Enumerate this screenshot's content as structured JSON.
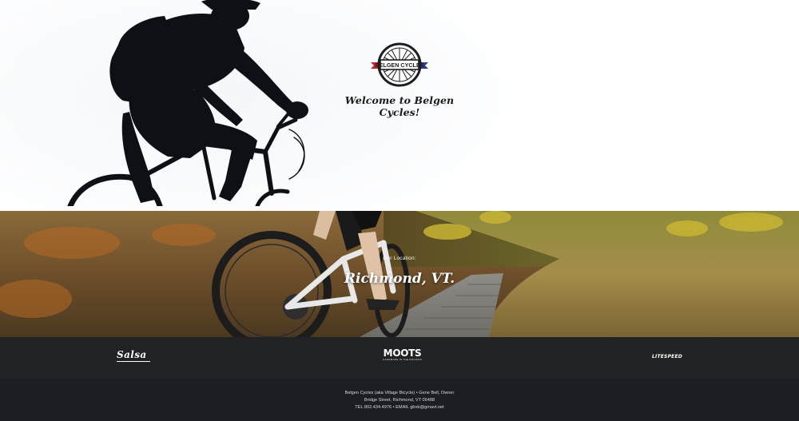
{
  "hero": {
    "welcome_text": "Welcome to Belgen Cycles!",
    "logo": {
      "text": "BELGEN CYCLES",
      "icon": "bicycle-wheel-logo",
      "ribbon_left_color": "#c8202e",
      "ribbon_right_color": "#2c3f8f"
    }
  },
  "location": {
    "label": "Our Location:",
    "city": "Richmond, VT."
  },
  "brands": {
    "items": [
      {
        "name": "Salsa"
      },
      {
        "name": "MOOTS",
        "tagline": "HANDMADE IN THE ROCKIES"
      },
      {
        "name": "LITESPEED"
      }
    ]
  },
  "footer": {
    "line1": "Belgen Cycles (aka Village Bicycle) • Gene Bell, Owner",
    "line2": "Bridge Street, Richmond, VT 05488",
    "line3": "TEL 802.434.4976 • EMAIL gbvb@gmavt.net"
  },
  "colors": {
    "brand_band_bg": "#212223",
    "footer_bg": "#1b1e23",
    "welcome_text": "#1a1a1a"
  }
}
